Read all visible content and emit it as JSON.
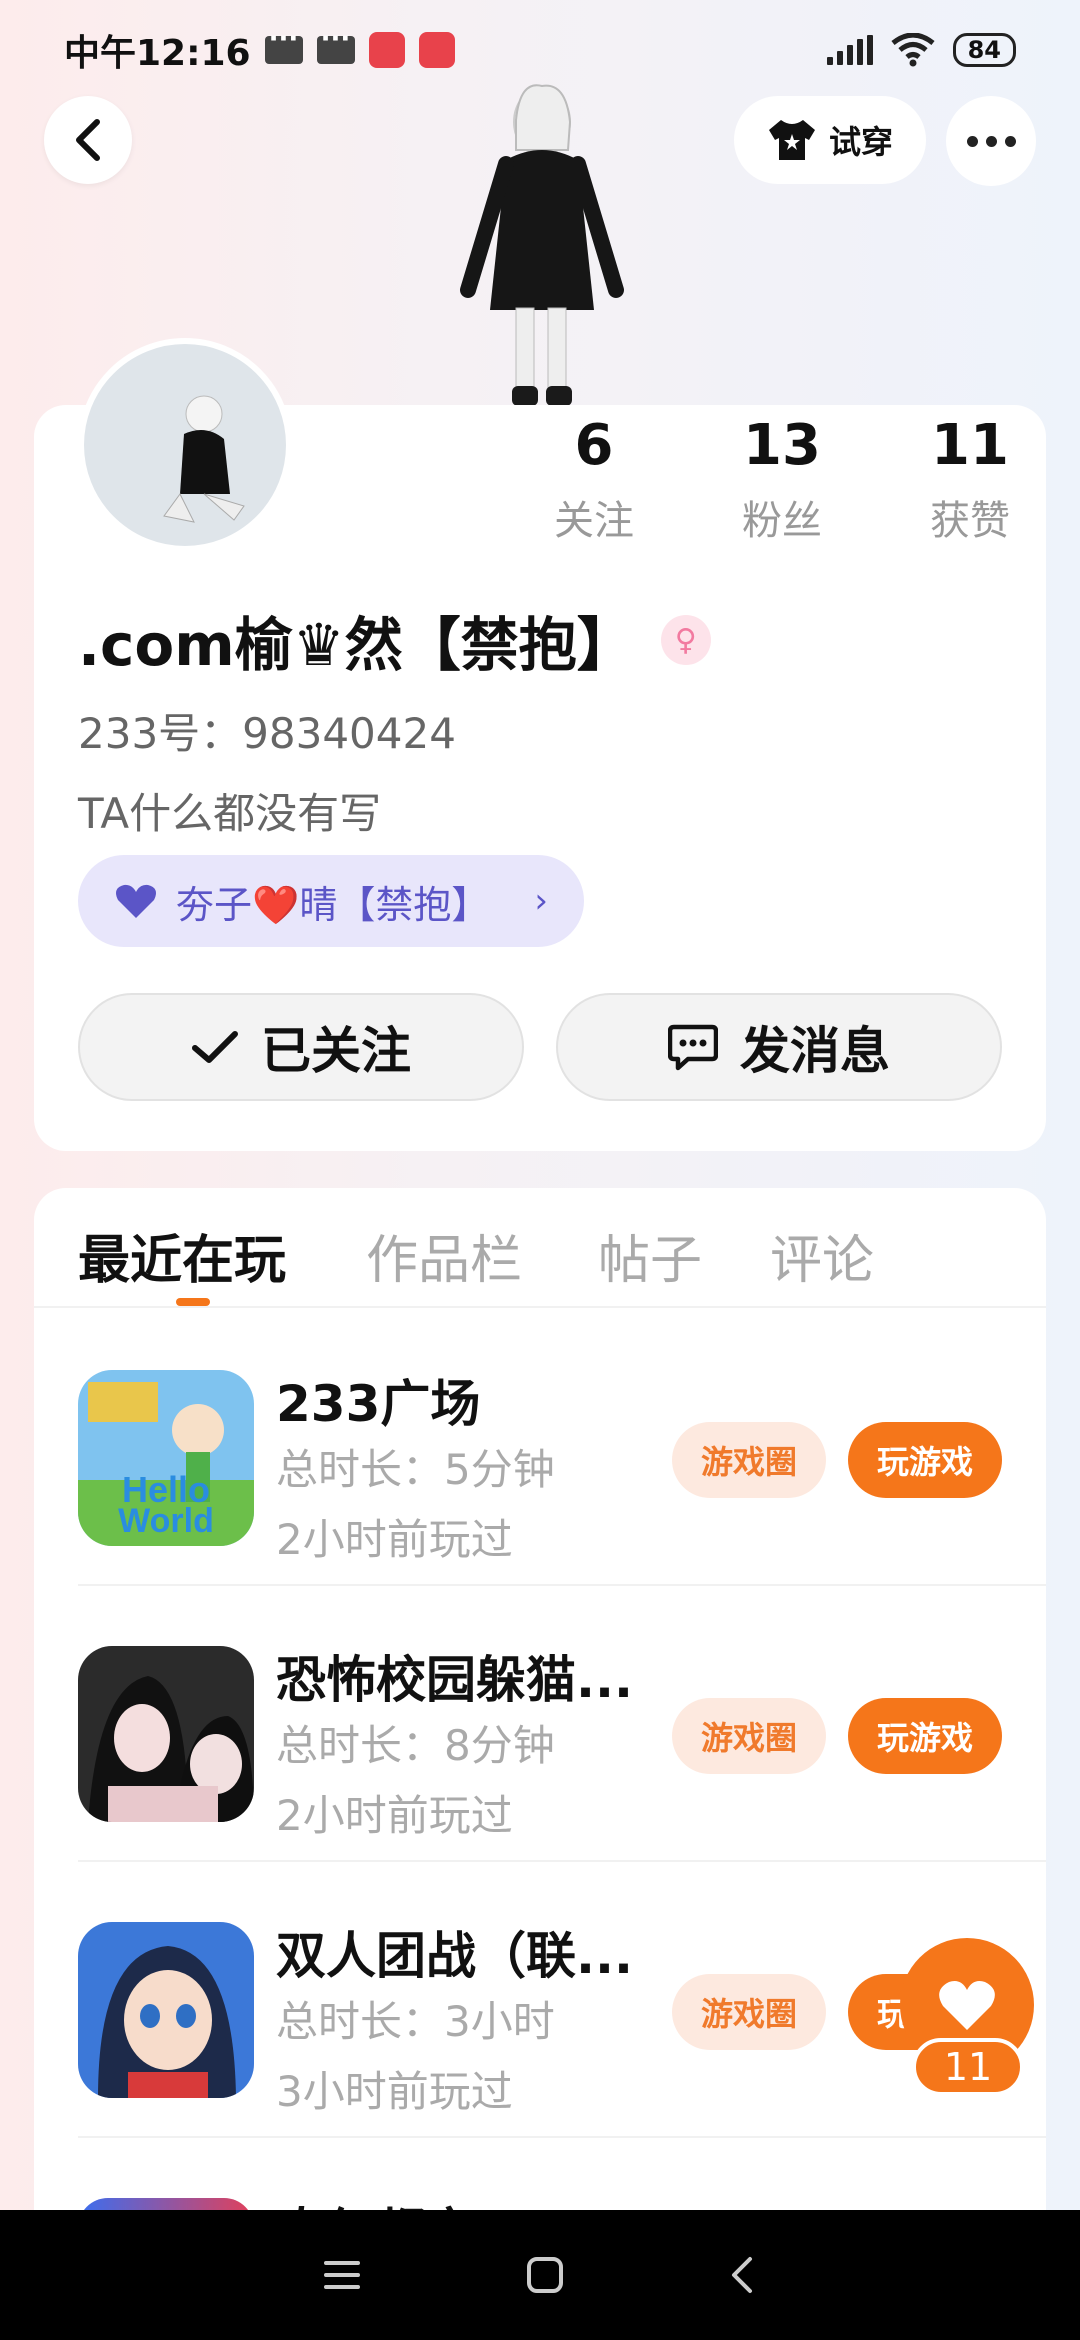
{
  "status_bar": {
    "time": "中午12:16",
    "battery": "84"
  },
  "header": {
    "tryon_label": "试穿"
  },
  "profile": {
    "nickname": ".com榆♛然【禁抱】",
    "gender_symbol": "♀",
    "uid": "233号：98340424",
    "bio": "TA什么都没有写",
    "stats": [
      {
        "value": "6",
        "label": "关注"
      },
      {
        "value": "13",
        "label": "粉丝"
      },
      {
        "value": "11",
        "label": "获赞"
      }
    ],
    "couple_tag": {
      "label": "夯子❤️晴【禁抱】"
    },
    "follow_label": "已关注",
    "message_label": "发消息"
  },
  "tabs": [
    {
      "label": "最近在玩",
      "active": true
    },
    {
      "label": "作品栏",
      "active": false
    },
    {
      "label": "帖子",
      "active": false
    },
    {
      "label": "评论",
      "active": false
    }
  ],
  "games": [
    {
      "title": "233广场",
      "duration": "总时长：5分钟",
      "last_played": "2小时前玩过",
      "circle_label": "游戏圈",
      "play_label": "玩游戏"
    },
    {
      "title": "恐怖校园躲猫...",
      "duration": "总时长：8分钟",
      "last_played": "2小时前玩过",
      "circle_label": "游戏圈",
      "play_label": "玩游戏"
    },
    {
      "title": "双人团战（联...",
      "duration": "总时长：3小时",
      "last_played": "3小时前玩过",
      "circle_label": "游戏圈",
      "play_label": "玩游戏"
    },
    {
      "title": "奇幻都市"
    }
  ],
  "like_float": {
    "count": "11"
  },
  "colors": {
    "accent": "#f5761a",
    "tag_bg": "#e8e6fb",
    "tag_text": "#5b55c7"
  }
}
